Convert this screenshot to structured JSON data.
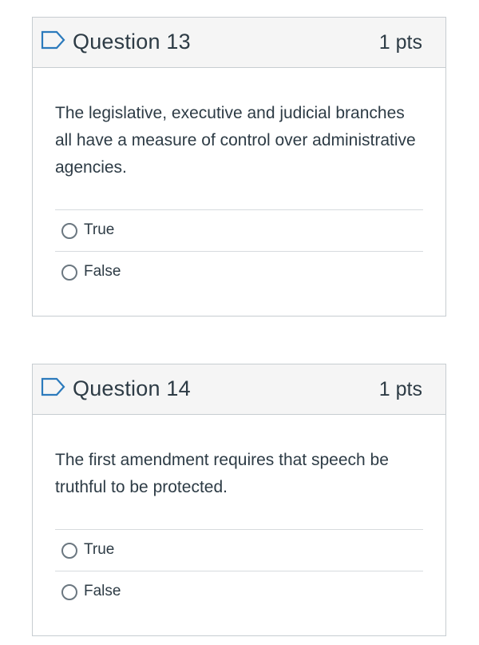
{
  "questions": [
    {
      "title": "Question 13",
      "points": "1 pts",
      "text": "The legislative, executive and judicial branches all have a measure of control over administrative agencies.",
      "answers": [
        "True",
        "False"
      ]
    },
    {
      "title": "Question 14",
      "points": "1 pts",
      "text": "The first amendment requires that speech be truthful to be protected.",
      "answers": [
        "True",
        "False"
      ]
    }
  ],
  "colors": {
    "header_bg": "#f5f5f5",
    "border": "#c7cdd1",
    "text": "#2d3b45",
    "flag_icon": "#2b7abc"
  },
  "icons": {
    "flag": "bookmark-flag-icon",
    "radio": "radio-circle"
  }
}
